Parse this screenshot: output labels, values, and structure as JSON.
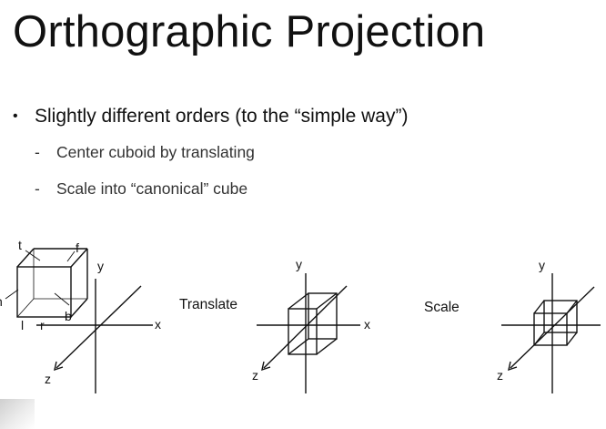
{
  "slide": {
    "title": "Orthographic Projection",
    "bullet": {
      "marker": "•",
      "text": "Slightly different orders (to the “simple way”)"
    },
    "sub_items": [
      {
        "marker": "-",
        "text": "Center cuboid by translating"
      },
      {
        "marker": "-",
        "text": "Scale into “canonical” cube"
      }
    ]
  },
  "diagram": {
    "step_labels": {
      "translate": "Translate",
      "scale": "Scale"
    },
    "axes": {
      "x": "x",
      "y": "y",
      "z": "z"
    },
    "face_labels": {
      "t": "t",
      "f": "f",
      "l": "l",
      "r": "r",
      "b": "b",
      "n": "n"
    }
  }
}
